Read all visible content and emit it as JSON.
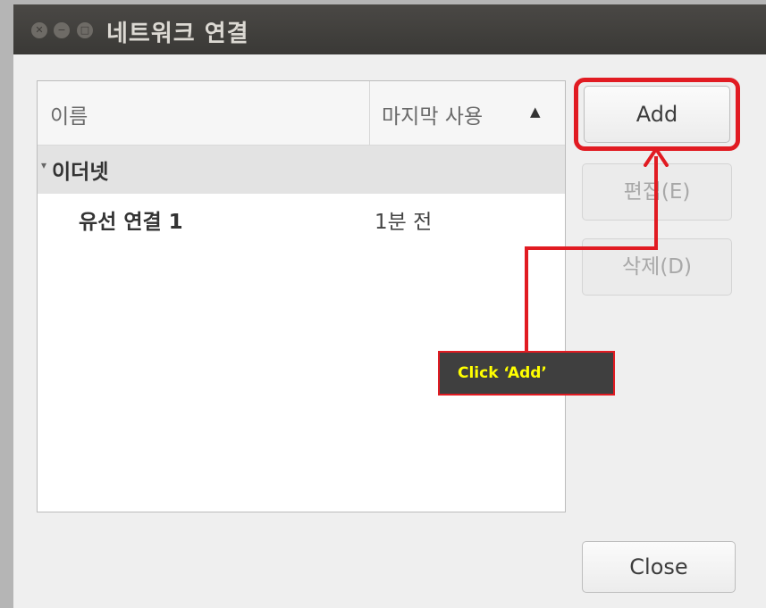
{
  "window": {
    "title": "네트워크 연결"
  },
  "list": {
    "columns": {
      "name": "이름",
      "last_used": "마지막 사용"
    },
    "sort_indicator": "▲",
    "groups": [
      {
        "label": "이더넷",
        "expander": "▾",
        "connections": [
          {
            "name": "유선 연결 1",
            "last_used": "1분 전"
          }
        ]
      }
    ]
  },
  "buttons": {
    "add": "Add",
    "edit": "편집(E)",
    "delete": "삭제(D)",
    "close": "Close"
  },
  "annotation": {
    "callout_text": "Click ‘Add’",
    "color": "#e11b22",
    "text_color": "#ffff00"
  }
}
